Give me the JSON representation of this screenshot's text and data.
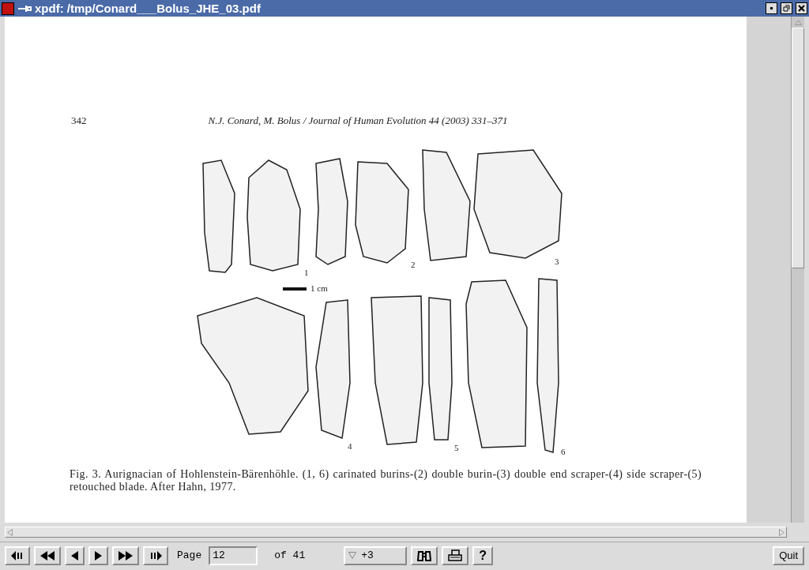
{
  "window": {
    "title": "xpdf: /tmp/Conard___Bolus_JHE_03.pdf"
  },
  "document": {
    "page_number": "342",
    "running_head": "N.J. Conard, M. Bolus / Journal of Human Evolution 44 (2003) 331–371",
    "figure": {
      "labels": [
        "1",
        "2",
        "3",
        "4",
        "5",
        "6"
      ],
      "scale": "1 cm"
    },
    "caption": "Fig. 3. Aurignacian of Hohlenstein-Bärenhöhle. (1, 6) carinated burins-(2) double burin-(3) double end scraper-(4) side scraper-(5) retouched blade. After Hahn, 1977."
  },
  "toolbar": {
    "page_label": "Page",
    "page_value": "12",
    "of_label": "of 41",
    "zoom": "+3",
    "help": "?",
    "quit": "Quit"
  }
}
